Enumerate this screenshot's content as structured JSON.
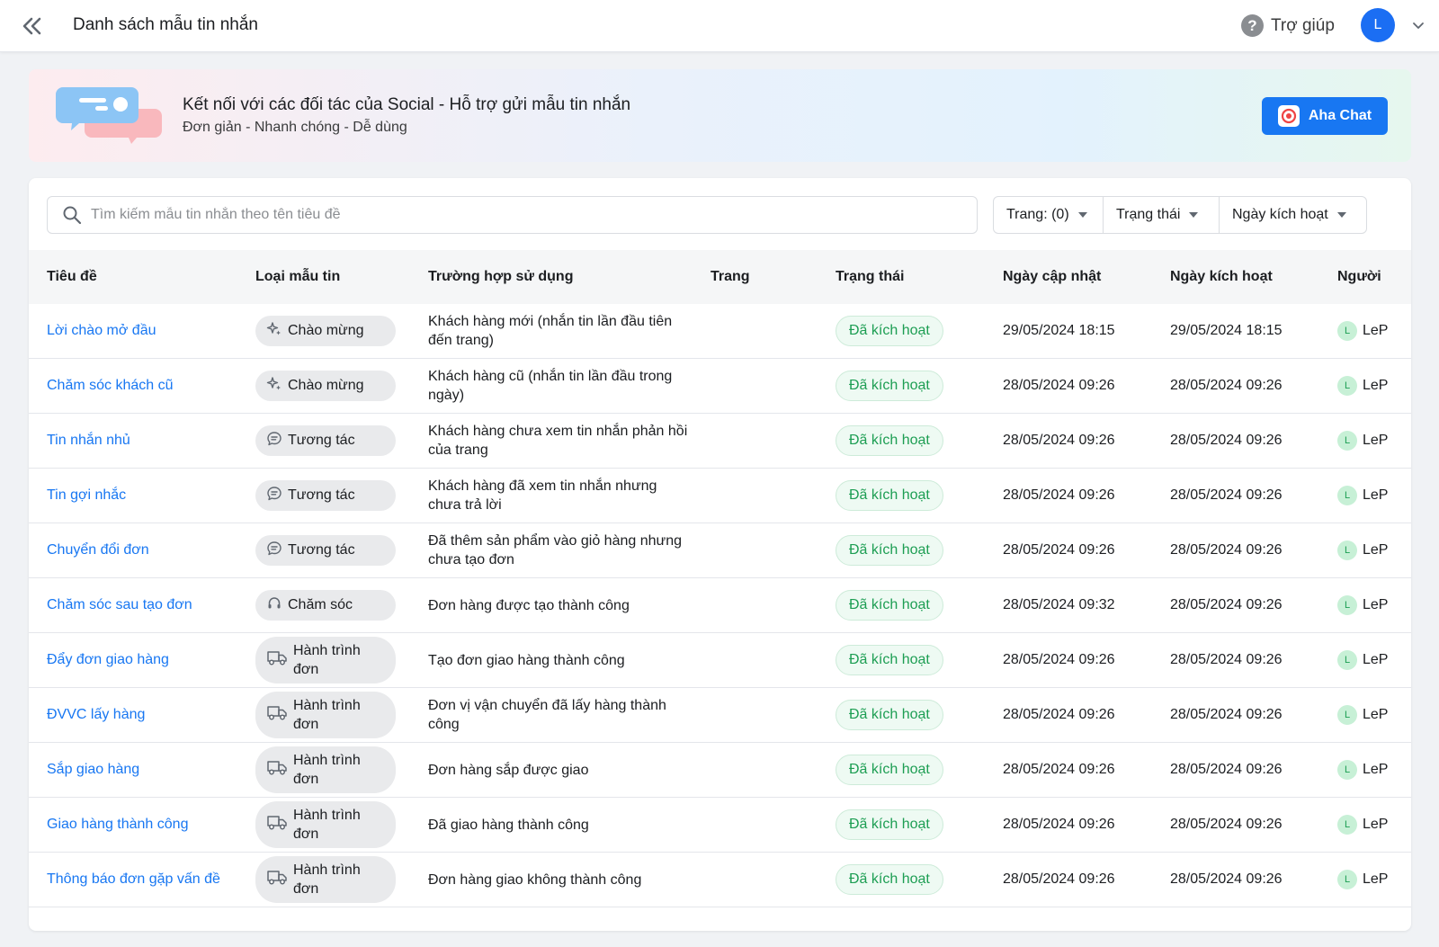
{
  "header": {
    "title": "Danh sách mẫu tin nhắn",
    "help_label": "Trợ giúp",
    "help_icon_glyph": "?",
    "avatar_initial": "L"
  },
  "banner": {
    "title": "Kết nối với các đối tác của Social - Hỗ trợ gửi mẫu tin nhắn",
    "subtitle": "Đơn giản - Nhanh chóng - Dễ dùng",
    "button_label": "Aha Chat"
  },
  "search": {
    "placeholder": "Tìm kiếm mẫu tin nhắn theo tên tiêu đề"
  },
  "filters": [
    {
      "label": "Trang: (0)"
    },
    {
      "label": "Trạng thái"
    },
    {
      "label": "Ngày kích hoạt"
    }
  ],
  "columns": [
    "Tiêu đề",
    "Loại mẫu tin",
    "Trường hợp sử dụng",
    "Trang",
    "Trạng thái",
    "Ngày cập nhật",
    "Ngày kích hoạt",
    "Người"
  ],
  "rows": [
    {
      "title": "Lời chào mở đầu",
      "type": "Chào mừng",
      "type_icon": "sparkle-icon",
      "usecase": "Khách hàng mới (nhắn tin lần đầu tiên đến trang)",
      "page": "",
      "status": "Đã kích hoạt",
      "updated": "29/05/2024 18:15",
      "activated": "29/05/2024 18:15",
      "creator_initial": "L",
      "creator": "LeP"
    },
    {
      "title": "Chăm sóc khách cũ",
      "type": "Chào mừng",
      "type_icon": "sparkle-icon",
      "usecase": "Khách hàng cũ (nhắn tin lần đầu trong ngày)",
      "page": "",
      "status": "Đã kích hoạt",
      "updated": "28/05/2024 09:26",
      "activated": "28/05/2024 09:26",
      "creator_initial": "L",
      "creator": "LeP"
    },
    {
      "title": "Tin nhắn nhủ",
      "type": "Tương tác",
      "type_icon": "chat-icon",
      "usecase": "Khách hàng chưa xem tin nhắn phản hồi của trang",
      "page": "",
      "status": "Đã kích hoạt",
      "updated": "28/05/2024 09:26",
      "activated": "28/05/2024 09:26",
      "creator_initial": "L",
      "creator": "LeP"
    },
    {
      "title": "Tin gợi nhắc",
      "type": "Tương tác",
      "type_icon": "chat-icon",
      "usecase": "Khách hàng đã xem tin nhắn nhưng chưa trả lời",
      "page": "",
      "status": "Đã kích hoạt",
      "updated": "28/05/2024 09:26",
      "activated": "28/05/2024 09:26",
      "creator_initial": "L",
      "creator": "LeP"
    },
    {
      "title": "Chuyển đổi đơn",
      "type": "Tương tác",
      "type_icon": "chat-icon",
      "usecase": "Đã thêm sản phẩm vào giỏ hàng nhưng chưa tạo đơn",
      "page": "",
      "status": "Đã kích hoạt",
      "updated": "28/05/2024 09:26",
      "activated": "28/05/2024 09:26",
      "creator_initial": "L",
      "creator": "LeP"
    },
    {
      "title": "Chăm sóc sau tạo đơn",
      "type": "Chăm sóc",
      "type_icon": "headset-icon",
      "usecase": "Đơn hàng được tạo thành công",
      "page": "",
      "status": "Đã kích hoạt",
      "updated": "28/05/2024 09:32",
      "activated": "28/05/2024 09:26",
      "creator_initial": "L",
      "creator": "LeP"
    },
    {
      "title": "Đẩy đơn giao hàng",
      "type": "Hành trình đơn",
      "type_icon": "truck-icon",
      "usecase": "Tạo đơn giao hàng thành công",
      "page": "",
      "status": "Đã kích hoạt",
      "updated": "28/05/2024 09:26",
      "activated": "28/05/2024 09:26",
      "creator_initial": "L",
      "creator": "LeP"
    },
    {
      "title": "ĐVVC lấy hàng",
      "type": "Hành trình đơn",
      "type_icon": "truck-icon",
      "usecase": "Đơn vị vận chuyển đã lấy hàng thành công",
      "page": "",
      "status": "Đã kích hoạt",
      "updated": "28/05/2024 09:26",
      "activated": "28/05/2024 09:26",
      "creator_initial": "L",
      "creator": "LeP"
    },
    {
      "title": "Sắp giao hàng",
      "type": "Hành trình đơn",
      "type_icon": "truck-icon",
      "usecase": "Đơn hàng sắp được giao",
      "page": "",
      "status": "Đã kích hoạt",
      "updated": "28/05/2024 09:26",
      "activated": "28/05/2024 09:26",
      "creator_initial": "L",
      "creator": "LeP"
    },
    {
      "title": "Giao hàng thành công",
      "type": "Hành trình đơn",
      "type_icon": "truck-icon",
      "usecase": "Đã giao hàng thành công",
      "page": "",
      "status": "Đã kích hoạt",
      "updated": "28/05/2024 09:26",
      "activated": "28/05/2024 09:26",
      "creator_initial": "L",
      "creator": "LeP"
    },
    {
      "title": "Thông báo đơn gặp vấn đề",
      "type": "Hành trình đơn",
      "type_icon": "truck-icon",
      "usecase": "Đơn hàng giao không thành công",
      "page": "",
      "status": "Đã kích hoạt",
      "updated": "28/05/2024 09:26",
      "activated": "28/05/2024 09:26",
      "creator_initial": "L",
      "creator": "LeP"
    }
  ],
  "colors": {
    "accent": "#1877f2",
    "status_green": "#1d9e53",
    "avatar_blue": "#1b6ef3"
  }
}
